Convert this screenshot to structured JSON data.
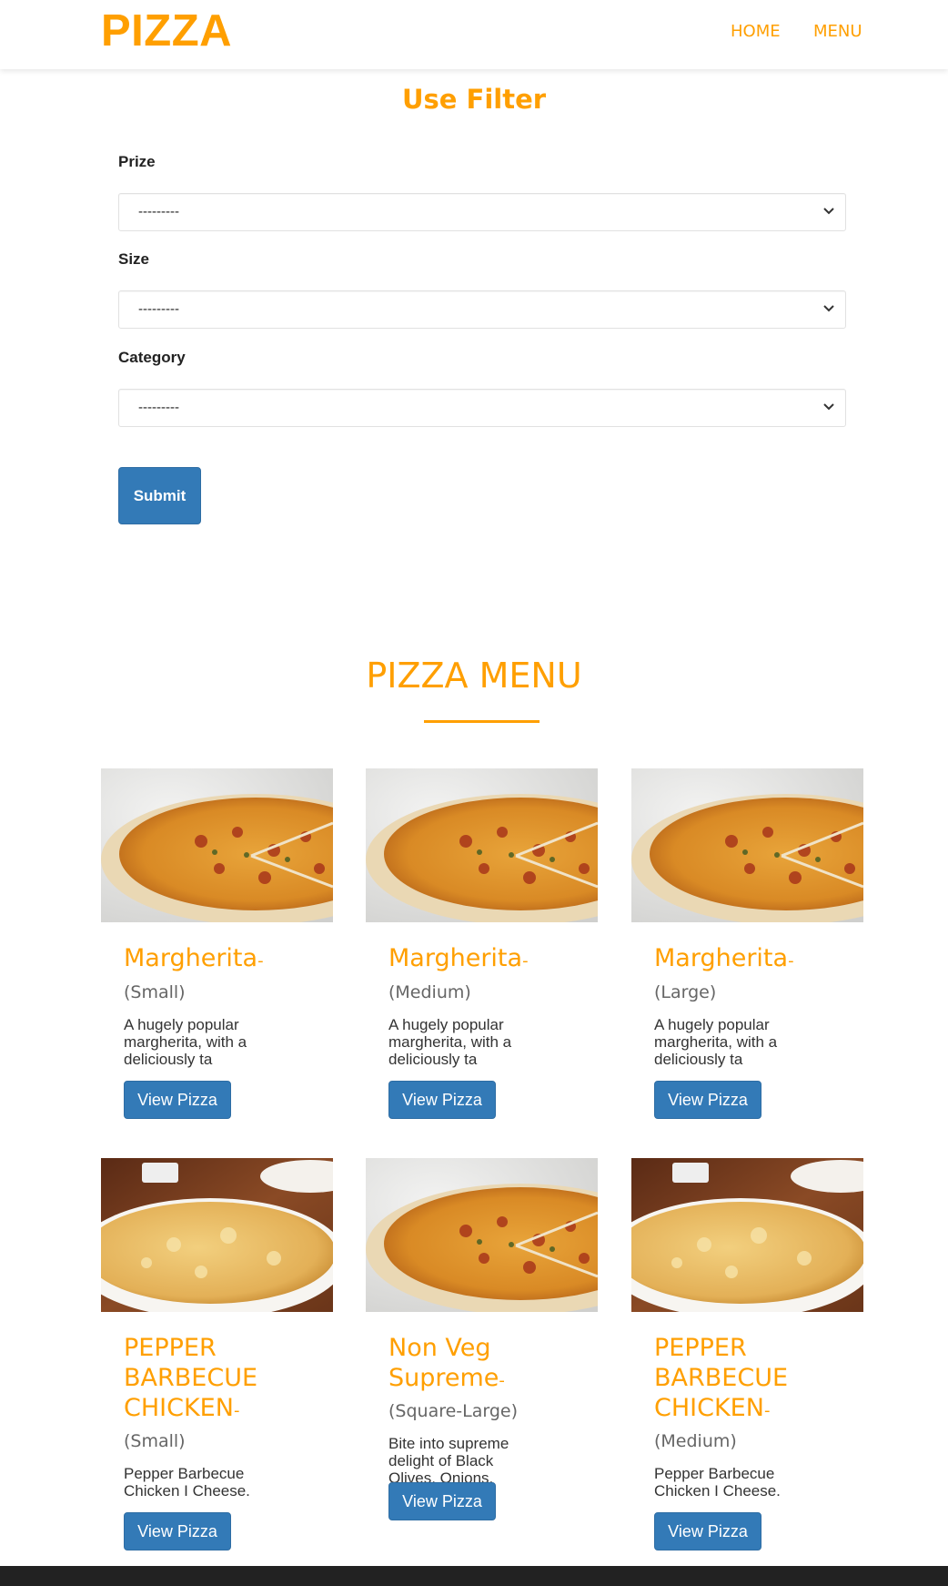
{
  "header": {
    "brand": "PIZZA",
    "nav": [
      "HOME",
      "MENU"
    ]
  },
  "filter": {
    "title": "Use Filter",
    "fields": [
      {
        "label": "Prize",
        "value": "---------"
      },
      {
        "label": "Size",
        "value": "---------"
      },
      {
        "label": "Category",
        "value": "---------"
      }
    ],
    "submit_label": "Submit"
  },
  "menu": {
    "title": "PIZZA MENU",
    "button_label": "View Pizza",
    "items": [
      {
        "name": "Margherita",
        "dash": "-",
        "size": "(Small)",
        "desc": "A hugely popular margherita, with a deliciously ta",
        "image": "pizza-pepperoni-slice"
      },
      {
        "name": "Margherita",
        "dash": "-",
        "size": "(Medium)",
        "desc": "A hugely popular margherita, with a deliciously ta",
        "image": "pizza-pepperoni-slice"
      },
      {
        "name": "Margherita",
        "dash": "-",
        "size": "(Large)",
        "desc": "A hugely popular margherita, with a deliciously ta",
        "image": "pizza-pepperoni-slice"
      },
      {
        "name": "PEPPER BARBECUE CHICKEN",
        "dash": "-",
        "size": "(Small)",
        "desc": "Pepper Barbecue Chicken I Cheese.",
        "image": "pizza-cheese-table"
      },
      {
        "name": "Non Veg Supreme",
        "dash": "-",
        "size": "(Square-Large)",
        "desc": "Bite into supreme delight of Black Olives, Onions,",
        "image": "pizza-pepperoni-slice"
      },
      {
        "name": "PEPPER BARBECUE CHICKEN",
        "dash": "-",
        "size": "(Medium)",
        "desc": "Pepper Barbecue Chicken I Cheese.",
        "image": "pizza-cheese-table"
      }
    ]
  },
  "colors": {
    "accent": "#ff9f00",
    "button": "#337ab7",
    "footer": "#222222"
  }
}
